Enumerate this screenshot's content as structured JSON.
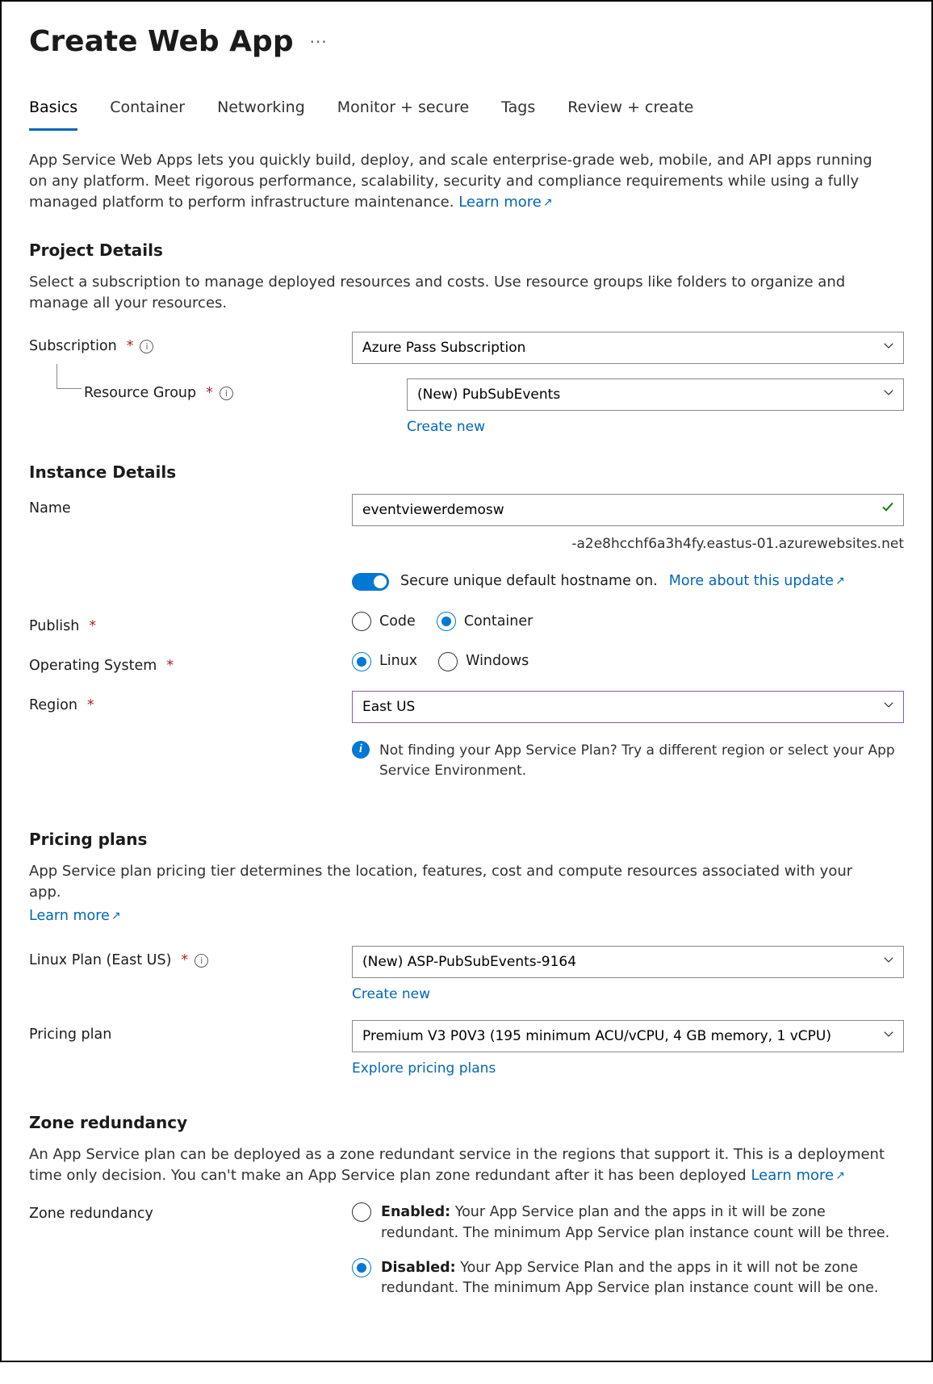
{
  "page_title": "Create Web App",
  "tabs": [
    "Basics",
    "Container",
    "Networking",
    "Monitor + secure",
    "Tags",
    "Review + create"
  ],
  "active_tab": 0,
  "intro": "App Service Web Apps lets you quickly build, deploy, and scale enterprise-grade web, mobile, and API apps running on any platform. Meet rigorous performance, scalability, security and compliance requirements while using a fully managed platform to perform infrastructure maintenance.  ",
  "learn_more": "Learn more",
  "project": {
    "heading": "Project Details",
    "desc": "Select a subscription to manage deployed resources and costs. Use resource groups like folders to organize and manage all your resources.",
    "subscription_label": "Subscription",
    "subscription_value": "Azure Pass Subscription",
    "rg_label": "Resource Group",
    "rg_value": "(New) PubSubEvents",
    "create_new": "Create new"
  },
  "instance": {
    "heading": "Instance Details",
    "name_label": "Name",
    "name_value": "eventviewerdemosw",
    "hostname_suffix": "-a2e8hcchf6a3h4fy.eastus-01.azurewebsites.net",
    "toggle_label": "Secure unique default hostname on.",
    "toggle_link": "More about this update",
    "publish_label": "Publish",
    "publish_options": [
      "Code",
      "Container"
    ],
    "publish_selected": 1,
    "os_label": "Operating System",
    "os_options": [
      "Linux",
      "Windows"
    ],
    "os_selected": 0,
    "region_label": "Region",
    "region_value": "East US",
    "plan_hint": "Not finding your App Service Plan? Try a different region or select your App Service Environment."
  },
  "pricing": {
    "heading": "Pricing plans",
    "desc": "App Service plan pricing tier determines the location, features, cost and compute resources associated with your app.",
    "learn_more": "Learn more",
    "plan_label": "Linux Plan (East US)",
    "plan_value": "(New) ASP-PubSubEvents-9164",
    "create_new": "Create new",
    "tier_label": "Pricing plan",
    "tier_value": "Premium V3 P0V3 (195 minimum ACU/vCPU, 4 GB memory, 1 vCPU)",
    "explore": "Explore pricing plans"
  },
  "zr": {
    "heading": "Zone redundancy",
    "desc": "An App Service plan can be deployed as a zone redundant service in the regions that support it. This is a deployment time only decision. You can't make an App Service plan zone redundant after it has been deployed ",
    "learn_more": "Learn more",
    "label": "Zone redundancy",
    "enabled_title": "Enabled:",
    "enabled_desc": " Your App Service plan and the apps in it will be zone redundant. The minimum App Service plan instance count will be three.",
    "disabled_title": "Disabled:",
    "disabled_desc": " Your App Service Plan and the apps in it will not be zone redundant. The minimum App Service plan instance count will be one.",
    "selected": 1
  }
}
